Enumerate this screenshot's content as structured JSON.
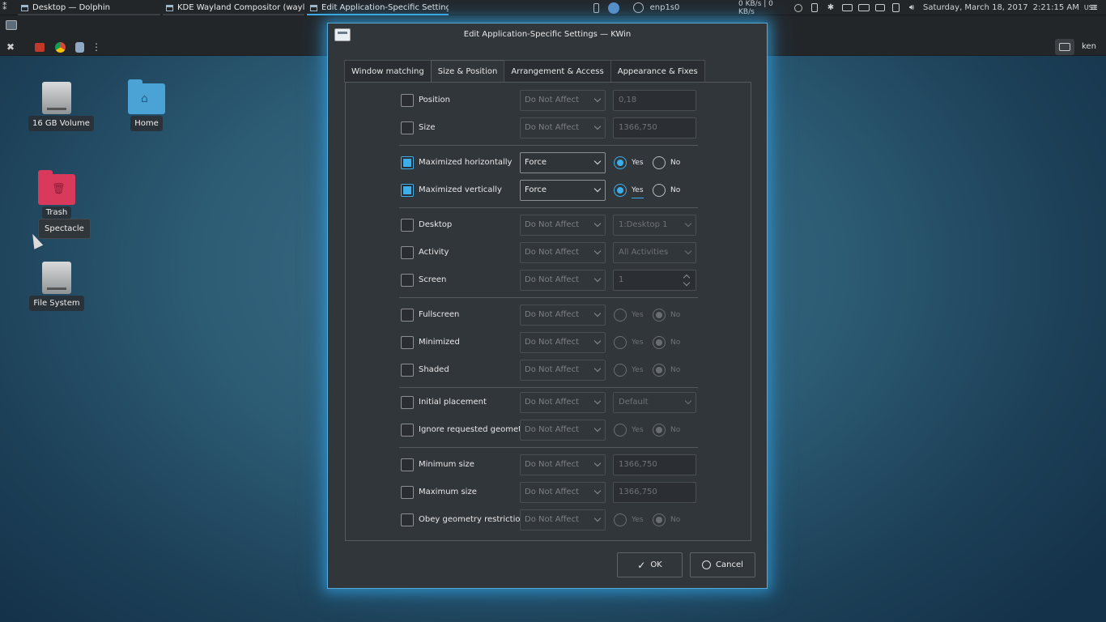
{
  "taskbar": {
    "tasks": [
      {
        "label": "Desktop — Dolphin"
      },
      {
        "label": "KDE Wayland Compositor (waylan···"
      },
      {
        "label": "Edit Application-Specific Settings ···"
      }
    ],
    "network": "enp1s0",
    "netspeed": "0 KB/s | 0 KB/s",
    "datetime": "Saturday, March 18, 2017",
    "clock": "2:21:15 AM",
    "tz": "UST",
    "user": "ken"
  },
  "desktop": {
    "icons": [
      {
        "label": "16 GB Volume",
        "icon": "drive-icon"
      },
      {
        "label": "Home",
        "icon": "home-folder-icon"
      },
      {
        "label": "Trash",
        "icon": "trash-icon"
      },
      {
        "label": "File System",
        "icon": "drive-icon"
      }
    ],
    "tooltip": "Spectacle"
  },
  "dialog": {
    "title": "Edit Application-Specific Settings — KWin",
    "tabs": [
      "Window matching",
      "Size & Position",
      "Arrangement & Access",
      "Appearance & Fixes"
    ],
    "yes": "Yes",
    "no": "No",
    "rows": [
      {
        "label": "Position",
        "policy": "Do Not Affect",
        "value": "0,18"
      },
      {
        "label": "Size",
        "policy": "Do Not Affect",
        "value": "1366,750"
      },
      {
        "label": "Maximized horizontally",
        "policy": "Force"
      },
      {
        "label": "Maximized vertically",
        "policy": "Force"
      },
      {
        "label": "Desktop",
        "policy": "Do Not Affect",
        "value": "1:Desktop 1"
      },
      {
        "label": "Activity",
        "policy": "Do Not Affect",
        "value": "All Activities"
      },
      {
        "label": "Screen",
        "policy": "Do Not Affect",
        "value": "1"
      },
      {
        "label": "Fullscreen",
        "policy": "Do Not Affect"
      },
      {
        "label": "Minimized",
        "policy": "Do Not Affect"
      },
      {
        "label": "Shaded",
        "policy": "Do Not Affect"
      },
      {
        "label": "Initial placement",
        "policy": "Do Not Affect",
        "value": "Default"
      },
      {
        "label": "Ignore requested geometry",
        "policy": "Do Not Affect"
      },
      {
        "label": "Minimum size",
        "policy": "Do Not Affect",
        "value": "1366,750"
      },
      {
        "label": "Maximum size",
        "policy": "Do Not Affect",
        "value": "1366,750"
      },
      {
        "label": "Obey geometry restrictions",
        "policy": "Do Not Affect"
      }
    ],
    "ok": "OK",
    "cancel": "Cancel"
  },
  "colors": {
    "accent": "#3daee9",
    "background": "#31363b"
  }
}
